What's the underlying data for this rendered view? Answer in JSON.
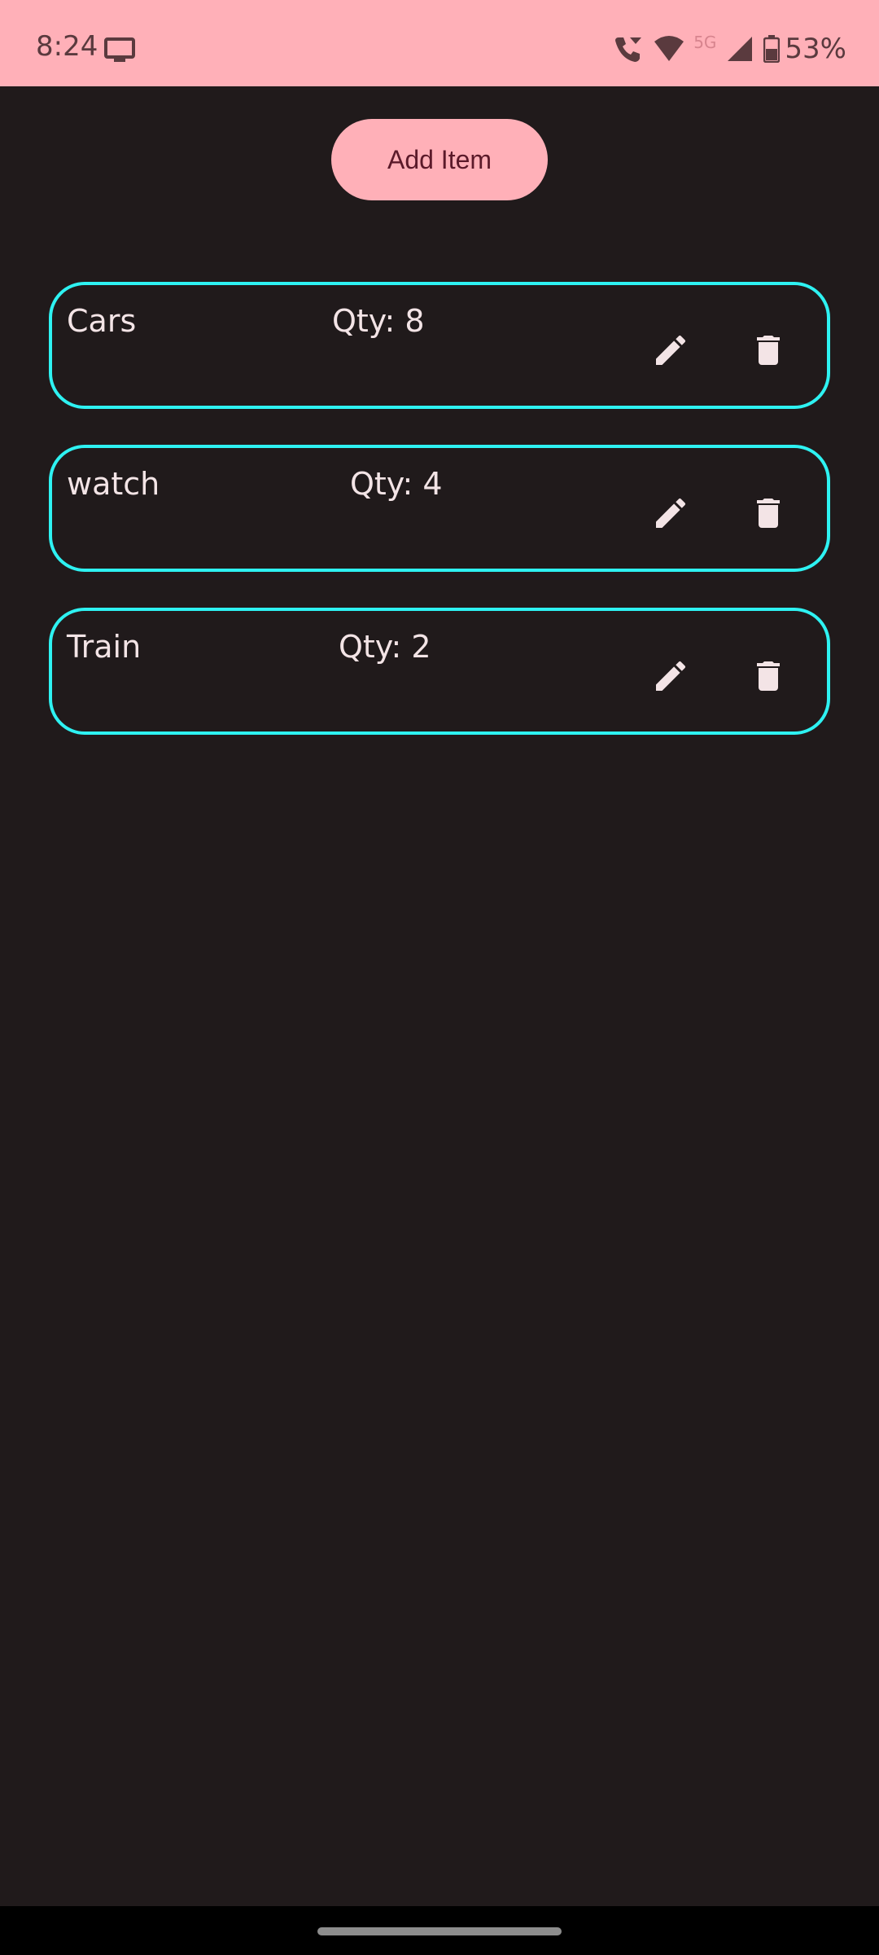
{
  "status_bar": {
    "time": "8:24",
    "network": "5G",
    "battery": "53%",
    "icons": [
      "screen-cast-icon",
      "wifi-call-icon",
      "wifi-icon",
      "signal-icon",
      "battery-icon"
    ]
  },
  "add_button": {
    "label": "Add Item"
  },
  "items": [
    {
      "name": "Cars",
      "qty": "Qty: 8"
    },
    {
      "name": "watch",
      "qty": "Qty: 4"
    },
    {
      "name": "Train",
      "qty": "Qty: 2"
    }
  ],
  "colors": {
    "accent": "#ffb0b8",
    "card_border": "#2ef2f2",
    "background": "#201a1b",
    "text": "#f3e4e6"
  }
}
